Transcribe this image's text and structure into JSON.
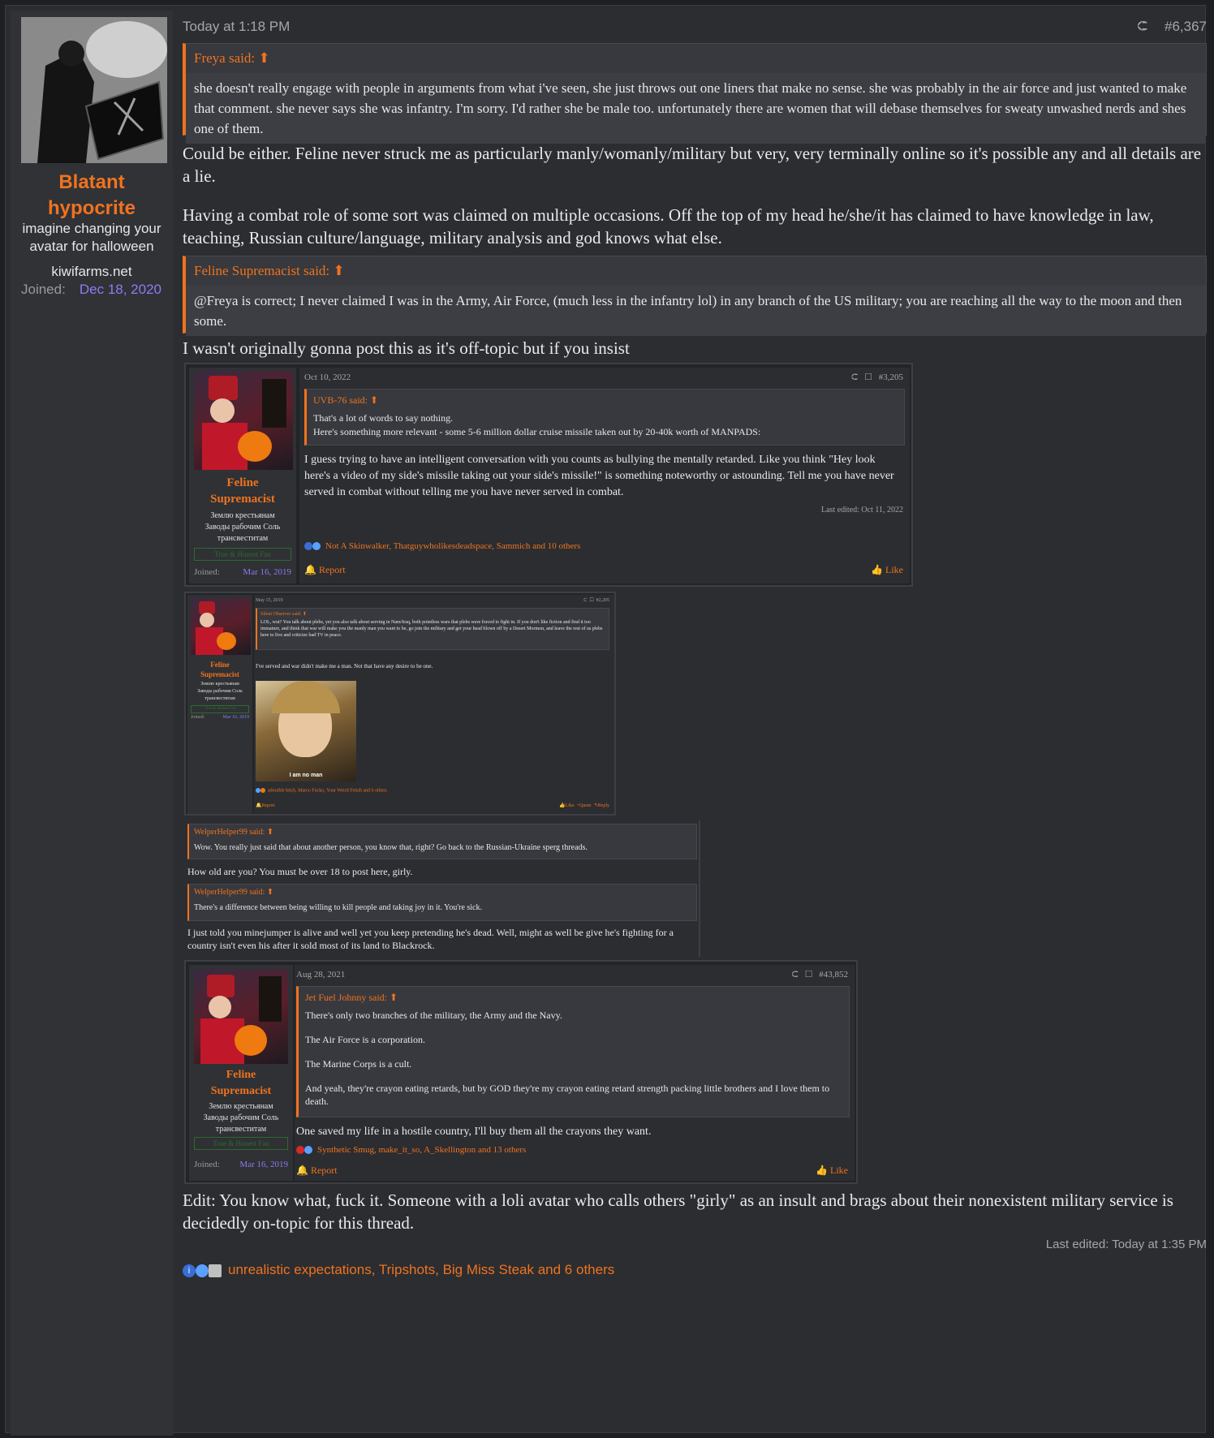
{
  "post": {
    "timestamp": "Today at 1:18 PM",
    "post_number": "#6,367",
    "author": {
      "name": "Blatant hypocrite",
      "name_line1": "Blatant",
      "name_line2": "hypocrite",
      "title_line1": "imagine changing your",
      "title_line2": "avatar for halloween",
      "site": "kiwifarms.net",
      "joined_label": "Joined:",
      "joined_value": "Dec 18, 2020"
    },
    "quote1": {
      "header": "Freya said:",
      "body": "she doesn't really engage with people in arguments from what i've seen, she just throws out one liners that make no sense. she was probably in the air force and just wanted to make that comment. she never says she was infantry. I'm sorry. I'd rather she be male too. unfortunately there are women that will debase themselves for sweaty unwashed nerds and shes one of them."
    },
    "para1": "Could be either. Feline never struck me as particularly manly/womanly/military but very, very terminally online so it's possible any and all details are a lie.",
    "para2": "Having a combat role of some sort was claimed on multiple occasions. Off the top of my head he/she/it has claimed to have knowledge in law, teaching, Russian culture/language, military analysis and god knows what else.",
    "quote2": {
      "header": "Feline Supremacist said:",
      "body": "@Freya is correct; I never claimed I was in the Army, Air Force, (much less in the infantry lol) in any branch of the US military; you are reaching all the way to the moon and then some."
    },
    "para3": "I wasn't originally gonna post this as it's off-topic but if you insist",
    "para4": "Edit: You know what, fuck it. Someone with a loli avatar who calls others \"girly\" as an insult and brags about their nonexistent military service is decidedly on-topic for this thread.",
    "last_edited": "Last edited: Today at 1:35 PM",
    "reactions": "unrealistic expectations, Tripshots, Big Miss Steak and 6 others"
  },
  "embed1": {
    "date": "Oct 10, 2022",
    "post_number": "#3,205",
    "author_line1": "Feline",
    "author_line2": "Supremacist",
    "title_line1": "Землю крестьянам",
    "title_line2": "Заводы рабочим Соль",
    "title_line3": "трансвеститам",
    "badge": "True & Honest Fan",
    "joined_label": "Joined:",
    "joined_value": "Mar 16, 2019",
    "quote_header": "UVB-76 said:",
    "quote_line1": "That's a lot of words to say nothing.",
    "quote_line2": "Here's something more relevant - some 5-6 million dollar cruise missile taken out by 20-40k worth of MANPADS:",
    "body": "I guess trying to have an intelligent conversation with you counts as bullying the mentally retarded. Like you think \"Hey look here's a video of my side's missile taking out your side's missile!\" is something noteworthy or astounding. Tell me you have never served in combat without telling me you have never served in combat.",
    "last_edited": "Last edited: Oct 11, 2022",
    "reactions": "Not A Skinwalker, Thatguywholikesdeadspace, Sammich and 10 others",
    "report": "Report",
    "like": "Like"
  },
  "embed2": {
    "date": "May 15, 2019",
    "post_number": "#2,205",
    "author_line1": "Feline",
    "author_line2": "Supremacist",
    "title_line1": "Землю крестьянам",
    "title_line2": "Заводы рабочим Соль",
    "title_line3": "трансвеститам",
    "badge": "True & Honest Fan",
    "joined_label": "Joined:",
    "joined_value": "Mar 16, 2019",
    "quote_header": "Silent Observer said:",
    "quote_body": "LOL, wut? You talk about plebs, yet you also talk about serving in Nam/Iraq, both pointless wars that plebs were forced to fight in. If you don't like fiction and find it too immature, and think that war will make you the manly man you want to be, go join the military and get your head blown off by a Desert Mormon, and leave the rest of us plebs here to live and criticize bad TV in peace.",
    "body": "I've served and war didn't make me a man. Not that have any desire to be one.",
    "image_caption": "I am no man",
    "reactions": "adorable bitch, Marco Fucko, Your Weird Fetish and 6 others",
    "report": "Report",
    "like": "Like",
    "quote_btn": "+Quote",
    "reply": "Reply"
  },
  "embed3": {
    "quote1_header": "WelperHelper99 said:",
    "quote1_body": "Wow. You really just said that about another person, you know that, right? Go back to the Russian-Ukraine sperg threads.",
    "text1": "How old are you? You must be over 18 to post here, girly.",
    "quote2_header": "WelperHelper99 said:",
    "quote2_body": "There's a difference between being willing to kill people and taking joy in it. You're sick.",
    "text2": "I just told you minejumper is alive and well yet you keep pretending he's dead. Well, might as well be give he's fighting for a country isn't even his after it sold most of its land to Blackrock."
  },
  "embed4": {
    "date": "Aug 28, 2021",
    "post_number": "#43,852",
    "author_line1": "Feline",
    "author_line2": "Supremacist",
    "title_line1": "Землю крестьянам",
    "title_line2": "Заводы рабочим Соль",
    "title_line3": "трансвеститам",
    "badge": "True & Honest Fan",
    "joined_label": "Joined:",
    "joined_value": "Mar 16, 2019",
    "quote_header": "Jet Fuel Johnny said:",
    "quote_line1": "There's only two branches of the military, the Army and the Navy.",
    "quote_line2": "The Air Force is a corporation.",
    "quote_line3": "The Marine Corps is a cult.",
    "quote_line4": "And yeah, they're crayon eating retards, but by GOD they're my crayon eating retard strength packing little brothers and I love them to death.",
    "body": "One saved my life in a hostile country, I'll buy them all the crayons they want.",
    "reactions": "Synthetic Smug, make_it_so, A_Skellington and 13 others",
    "report": "Report",
    "like": "Like"
  },
  "colors": {
    "accent": "#f0731e",
    "joined": "#8d7cf0",
    "bg": "#2b2d31"
  }
}
